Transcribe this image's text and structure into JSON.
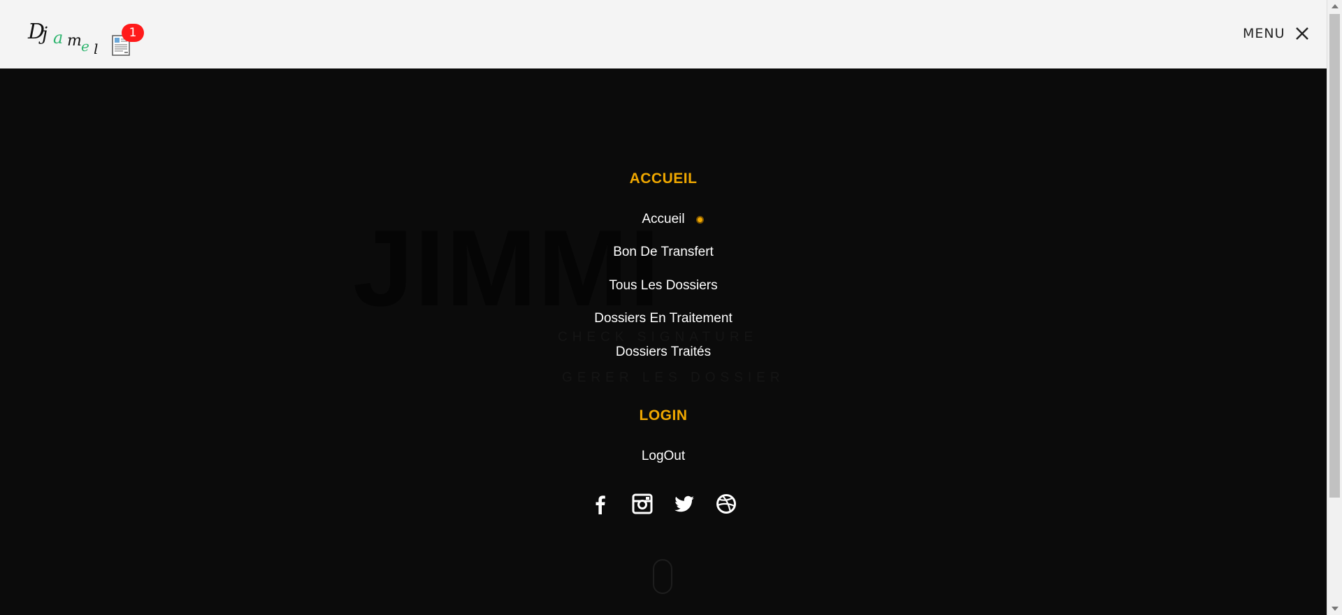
{
  "header": {
    "logo_text": "Djamel",
    "notification_count": "1",
    "menu_label": "MENU"
  },
  "hero": {
    "title": "JIMMI",
    "line1": "CHECK SIGNATURE",
    "line2": "GERER LES DOSSIER"
  },
  "nav": {
    "sections": [
      {
        "heading": "ACCUEIL",
        "items": [
          "Accueil",
          "Bon De Transfert",
          "Tous Les Dossiers",
          "Dossiers En Traitement",
          "Dossiers Traités"
        ]
      },
      {
        "heading": "LOGIN",
        "items": [
          "LogOut"
        ]
      }
    ],
    "active_item": "Accueil"
  },
  "social": [
    "facebook-icon",
    "instagram-icon",
    "twitter-icon",
    "dribbble-icon"
  ],
  "colors": {
    "accent": "#f0a800",
    "badge": "#ff1a1a",
    "header_bg": "#f4f4f4",
    "overlay_bg": "#0b0b0b"
  }
}
